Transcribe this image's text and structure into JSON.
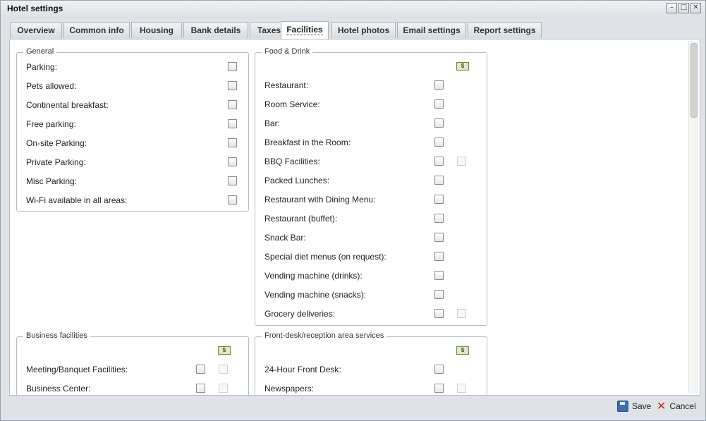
{
  "window": {
    "title": "Hotel settings"
  },
  "tabs": [
    "Overview",
    "Common info",
    "Housing",
    "Bank details",
    "Taxes",
    "Facilities",
    "Hotel photos",
    "Email settings",
    "Report settings"
  ],
  "active_tab": "Facilities",
  "money_badge": "$",
  "groups": {
    "general": {
      "title": "General",
      "items": [
        "Parking:",
        "Pets allowed:",
        "Continental breakfast:",
        "Free parking:",
        "On-site Parking:",
        "Private Parking:",
        "Misc Parking:",
        "Wi-Fi available in all areas:"
      ]
    },
    "food": {
      "title": "Food & Drink",
      "items": [
        "Restaurant:",
        "Room Service:",
        "Bar:",
        "Breakfast in the Room:",
        "BBQ Facilities:",
        "Packed Lunches:",
        "Restaurant with Dining Menu:",
        "Restaurant (buffet):",
        "Snack Bar:",
        "Special diet menus (on request):",
        "Vending machine (drinks):",
        "Vending machine (snacks):",
        "Grocery deliveries:"
      ]
    },
    "business": {
      "title": "Business facilities",
      "items": [
        "Meeting/Banquet Facilities:",
        "Business Center:"
      ]
    },
    "frontdesk": {
      "title": "Front-desk/reception area services",
      "items": [
        "24-Hour Front Desk:",
        "Newspapers:"
      ]
    }
  },
  "footer": {
    "save": "Save",
    "cancel": "Cancel"
  }
}
